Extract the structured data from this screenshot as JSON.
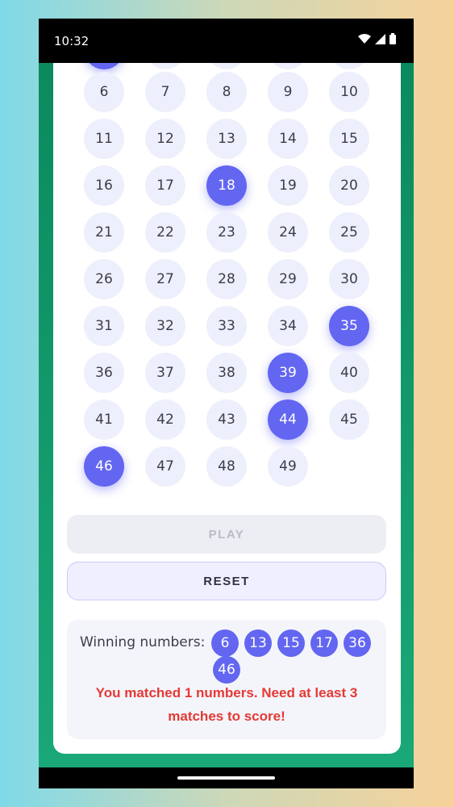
{
  "status": {
    "time": "10:32"
  },
  "grid": {
    "partial_row": [
      "",
      "",
      "",
      "",
      ""
    ],
    "rows": [
      [
        "6",
        "7",
        "8",
        "9",
        "10"
      ],
      [
        "11",
        "12",
        "13",
        "14",
        "15"
      ],
      [
        "16",
        "17",
        "18",
        "19",
        "20"
      ],
      [
        "21",
        "22",
        "23",
        "24",
        "25"
      ],
      [
        "26",
        "27",
        "28",
        "29",
        "30"
      ],
      [
        "31",
        "32",
        "33",
        "34",
        "35"
      ],
      [
        "36",
        "37",
        "38",
        "39",
        "40"
      ],
      [
        "41",
        "42",
        "43",
        "44",
        "45"
      ],
      [
        "46",
        "47",
        "48",
        "49"
      ]
    ],
    "selected": [
      "18",
      "35",
      "39",
      "44",
      "46"
    ]
  },
  "buttons": {
    "play": "PLAY",
    "reset": "RESET"
  },
  "results": {
    "label": "Winning numbers:",
    "numbers": [
      "6",
      "13",
      "15",
      "17",
      "36",
      "46"
    ],
    "message": "You matched 1 numbers. Need at least 3 matches to score!"
  },
  "colors": {
    "accent": "#6366f1",
    "error": "#e53935",
    "ball_bg": "#eeeffc"
  }
}
